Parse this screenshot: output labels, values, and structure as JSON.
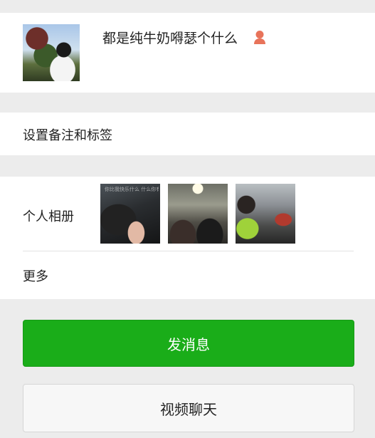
{
  "profile": {
    "nickname": "都是纯牛奶嘚瑟个什么",
    "gender_icon": "female-person-icon",
    "avatar_icon": "profile-photo"
  },
  "remark": {
    "label": "设置备注和标签"
  },
  "album": {
    "label": "个人相册",
    "thumb1_caption": "你比我快乐什么\n什么你有什么"
  },
  "more": {
    "label": "更多"
  },
  "actions": {
    "message_label": "发消息",
    "video_label": "视频聊天"
  },
  "colors": {
    "primary_green": "#1aad19",
    "gender_icon_color": "#e8735a",
    "background": "#efefef"
  }
}
